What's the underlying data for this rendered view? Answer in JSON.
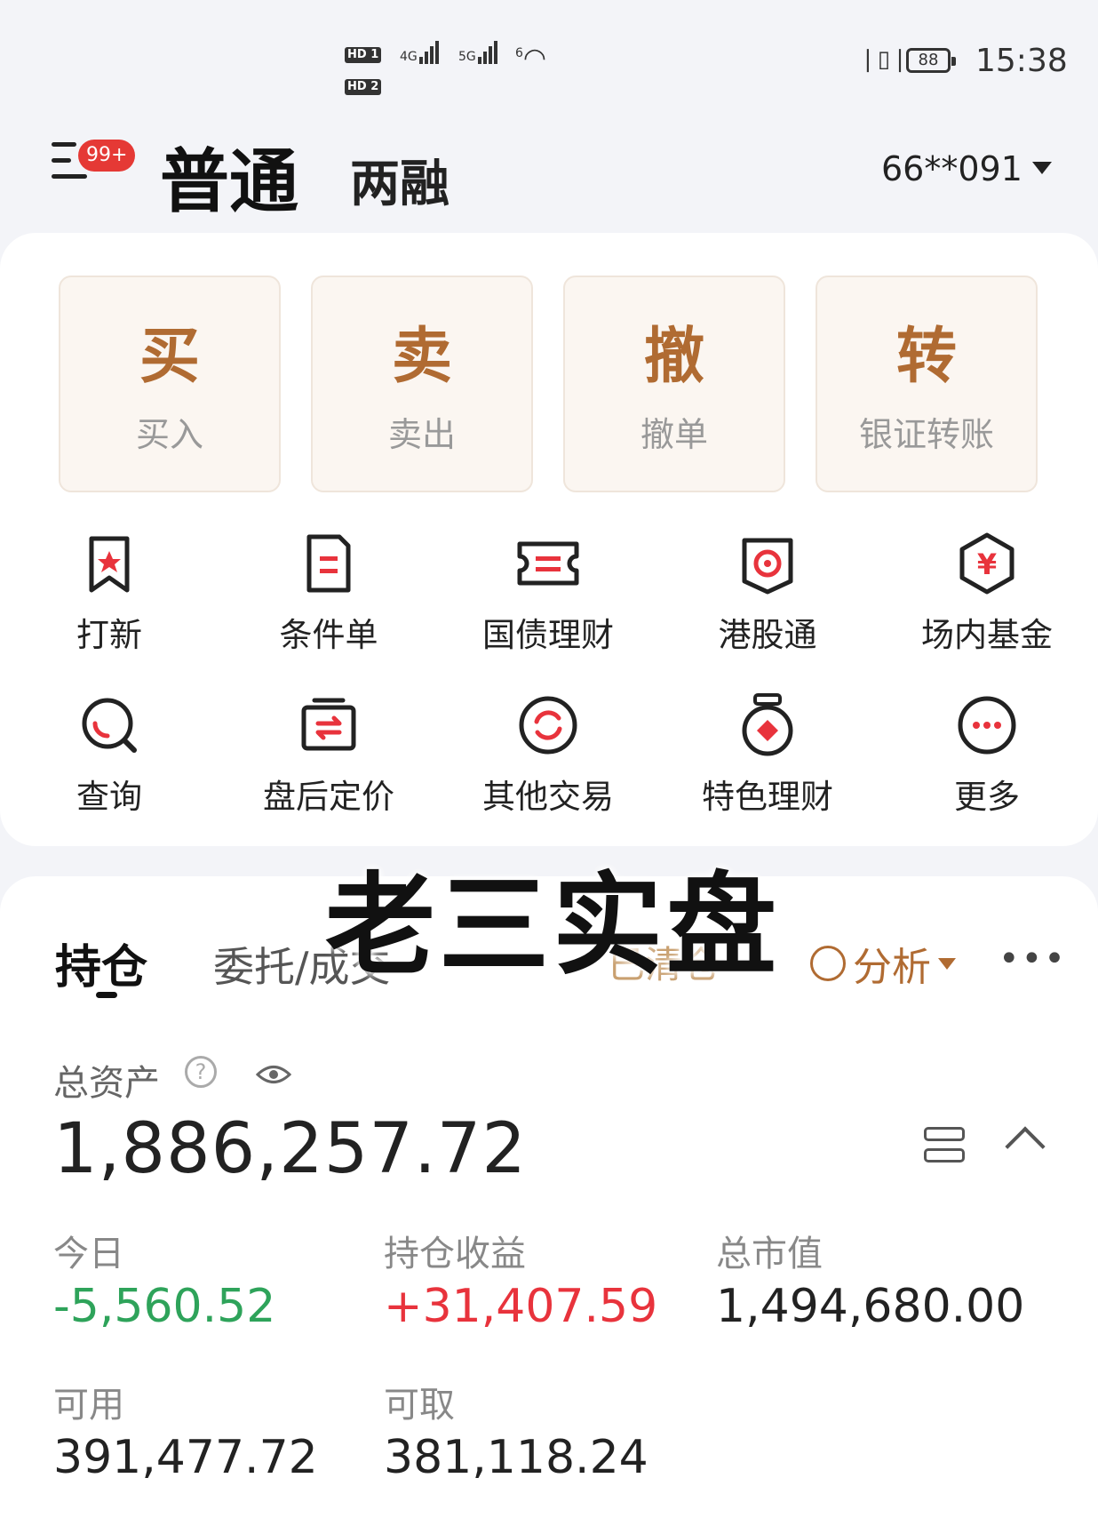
{
  "status_bar": {
    "sim1": "HD 1",
    "sim2": "HD 2",
    "net1": "4G",
    "net2": "5G",
    "wifi": "6",
    "battery": "88",
    "time": "15:38"
  },
  "header": {
    "badge": "99+",
    "tab_main": "普通",
    "tab_margin": "两融",
    "account": "66**091"
  },
  "primary_actions": [
    {
      "glyph": "买",
      "label": "买入"
    },
    {
      "glyph": "卖",
      "label": "卖出"
    },
    {
      "glyph": "撤",
      "label": "撤单"
    },
    {
      "glyph": "转",
      "label": "银证转账"
    }
  ],
  "functions_row1": [
    {
      "label": "打新",
      "icon": "bookmark-star-icon"
    },
    {
      "label": "条件单",
      "icon": "document-icon"
    },
    {
      "label": "国债理财",
      "icon": "ticket-icon"
    },
    {
      "label": "港股通",
      "icon": "hk-flower-icon"
    },
    {
      "label": "场内基金",
      "icon": "yen-hexagon-icon"
    }
  ],
  "functions_row2": [
    {
      "label": "查询",
      "icon": "search-icon"
    },
    {
      "label": "盘后定价",
      "icon": "exchange-icon"
    },
    {
      "label": "其他交易",
      "icon": "refresh-icon"
    },
    {
      "label": "特色理财",
      "icon": "medal-icon"
    },
    {
      "label": "更多",
      "icon": "more-icon"
    }
  ],
  "holdings": {
    "tab_active": "持仓",
    "tab_other": "委托/成交",
    "cleared": "已清仓",
    "analysis": "分析"
  },
  "assets": {
    "total_label": "总资产",
    "total_value": "1,886,257.72",
    "today_label": "今日",
    "today_value": "-5,560.52",
    "profit_label": "持仓收益",
    "profit_value": "+31,407.59",
    "market_label": "总市值",
    "market_value": "1,494,680.00",
    "available_label": "可用",
    "available_value": "391,477.72",
    "withdrawable_label": "可取",
    "withdrawable_value": "381,118.24"
  },
  "watermark": "老三实盘",
  "colors": {
    "accent": "#b06b32",
    "negative": "#2ea35a",
    "positive": "#e8333c",
    "badge": "#e53935"
  }
}
